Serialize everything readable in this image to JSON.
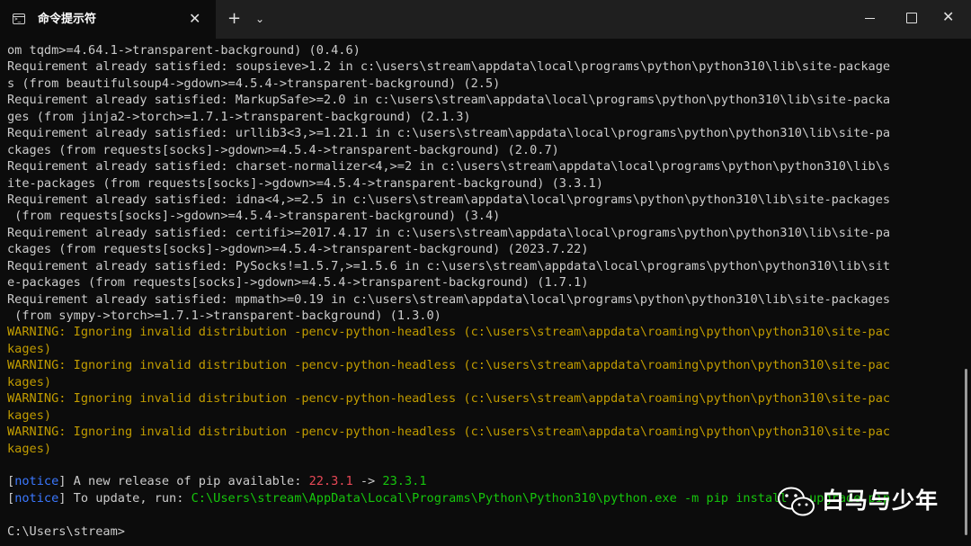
{
  "window": {
    "tab_title": "命令提示符",
    "close_tab_glyph": "✕",
    "new_tab_glyph": "+",
    "dropdown_glyph": "⌄",
    "close_window_glyph": "✕"
  },
  "terminal": {
    "lines": [
      "om tqdm>=4.64.1->transparent-background) (0.4.6)",
      "Requirement already satisfied: soupsieve>1.2 in c:\\users\\stream\\appdata\\local\\programs\\python\\python310\\lib\\site-package",
      "s (from beautifulsoup4->gdown>=4.5.4->transparent-background) (2.5)",
      "Requirement already satisfied: MarkupSafe>=2.0 in c:\\users\\stream\\appdata\\local\\programs\\python\\python310\\lib\\site-packa",
      "ges (from jinja2->torch>=1.7.1->transparent-background) (2.1.3)",
      "Requirement already satisfied: urllib3<3,>=1.21.1 in c:\\users\\stream\\appdata\\local\\programs\\python\\python310\\lib\\site-pa",
      "ckages (from requests[socks]->gdown>=4.5.4->transparent-background) (2.0.7)",
      "Requirement already satisfied: charset-normalizer<4,>=2 in c:\\users\\stream\\appdata\\local\\programs\\python\\python310\\lib\\s",
      "ite-packages (from requests[socks]->gdown>=4.5.4->transparent-background) (3.3.1)",
      "Requirement already satisfied: idna<4,>=2.5 in c:\\users\\stream\\appdata\\local\\programs\\python\\python310\\lib\\site-packages",
      " (from requests[socks]->gdown>=4.5.4->transparent-background) (3.4)",
      "Requirement already satisfied: certifi>=2017.4.17 in c:\\users\\stream\\appdata\\local\\programs\\python\\python310\\lib\\site-pa",
      "ckages (from requests[socks]->gdown>=4.5.4->transparent-background) (2023.7.22)",
      "Requirement already satisfied: PySocks!=1.5.7,>=1.5.6 in c:\\users\\stream\\appdata\\local\\programs\\python\\python310\\lib\\sit",
      "e-packages (from requests[socks]->gdown>=4.5.4->transparent-background) (1.7.1)",
      "Requirement already satisfied: mpmath>=0.19 in c:\\users\\stream\\appdata\\local\\programs\\python\\python310\\lib\\site-packages",
      " (from sympy->torch>=1.7.1->transparent-background) (1.3.0)"
    ],
    "warnings": [
      "WARNING: Ignoring invalid distribution -pencv-python-headless (c:\\users\\stream\\appdata\\roaming\\python\\python310\\site-pac",
      "kages)",
      "WARNING: Ignoring invalid distribution -pencv-python-headless (c:\\users\\stream\\appdata\\roaming\\python\\python310\\site-pac",
      "kages)",
      "WARNING: Ignoring invalid distribution -pencv-python-headless (c:\\users\\stream\\appdata\\roaming\\python\\python310\\site-pac",
      "kages)",
      "WARNING: Ignoring invalid distribution -pencv-python-headless (c:\\users\\stream\\appdata\\roaming\\python\\python310\\site-pac",
      "kages)"
    ],
    "notice_open": "[",
    "notice_tag": "notice",
    "notice_close": "]",
    "notice1_text": " A new release of pip available: ",
    "notice1_old": "22.3.1",
    "notice1_arrow": " -> ",
    "notice1_new": "23.3.1",
    "notice2_text": " To update, run: ",
    "notice2_cmd": "C:\\Users\\stream\\AppData\\Local\\Programs\\Python\\Python310\\python.exe -m pip install --upgrade pip",
    "prompt": "C:\\Users\\stream>"
  },
  "watermark": {
    "text": "白马与少年"
  }
}
